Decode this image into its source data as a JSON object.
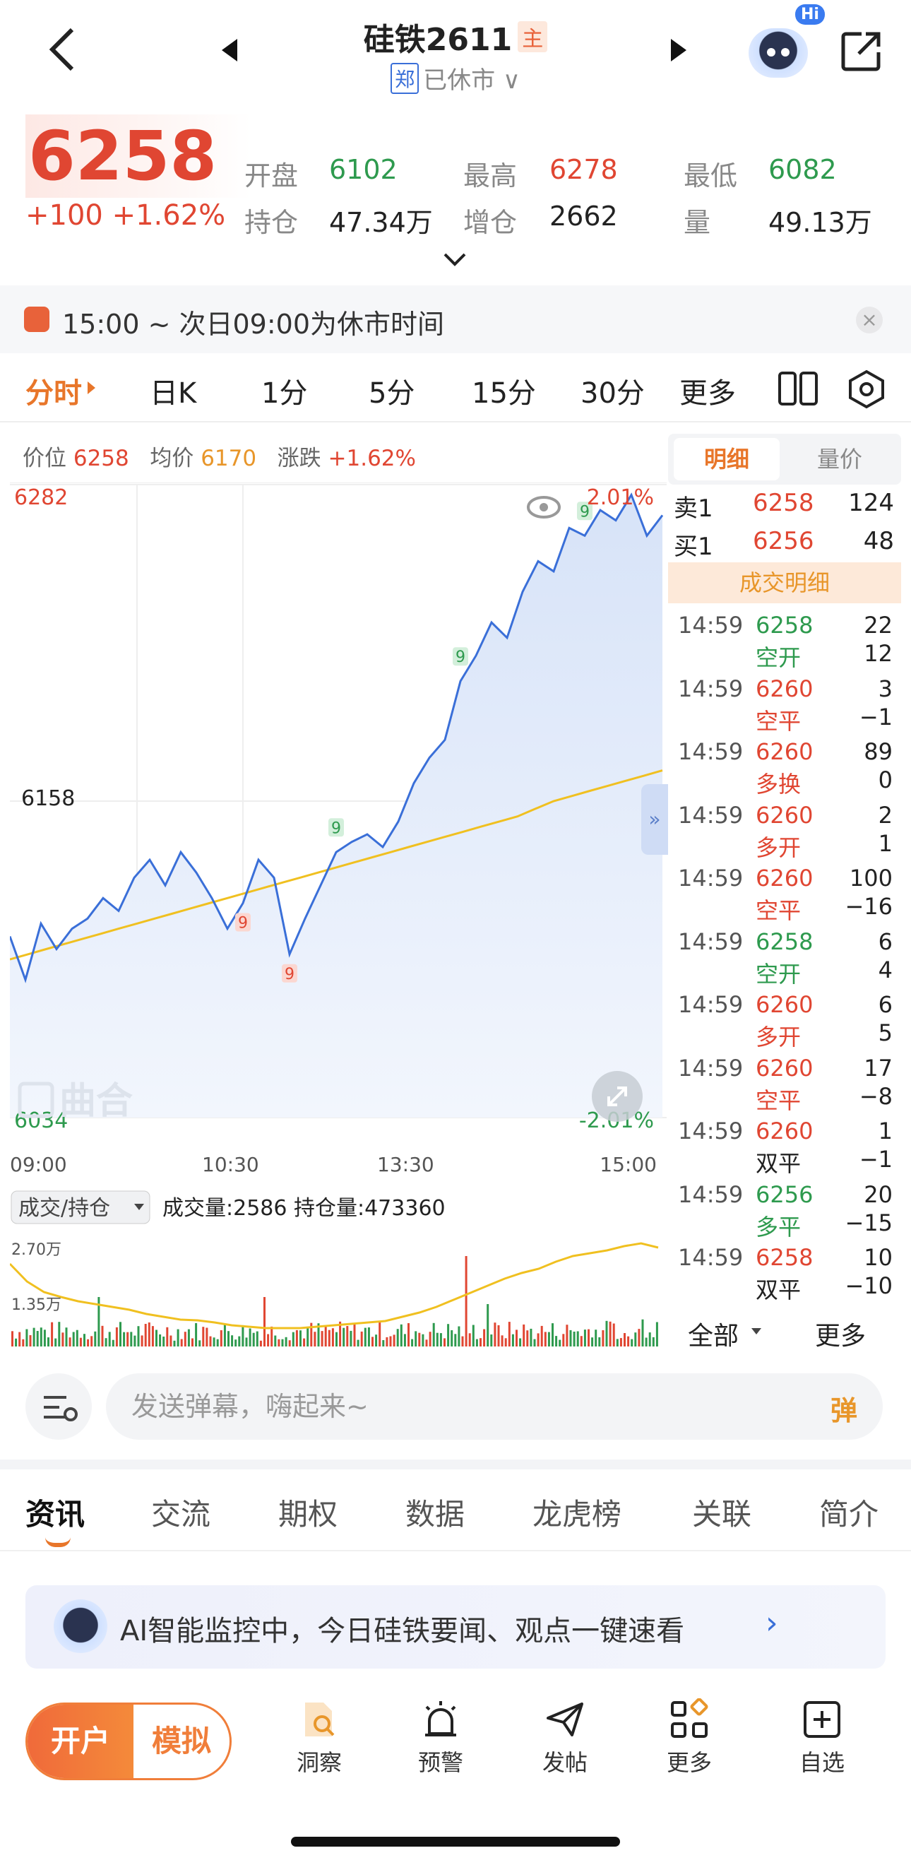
{
  "header": {
    "title": "硅铁2611",
    "badge": "主",
    "exchange_badge": "郑",
    "status": "已休市",
    "hi_badge": "Hi"
  },
  "quote": {
    "price": "6258",
    "change": "+100 +1.62%",
    "open_label": "开盘",
    "open": "6102",
    "high_label": "最高",
    "high": "6278",
    "low_label": "最低",
    "low": "6082",
    "oi_label": "持仓",
    "oi": "47.34万",
    "oi_change_label": "增仓",
    "oi_change": "2662",
    "vol_label": "量",
    "vol": "49.13万"
  },
  "notice": {
    "text": "15:00 ~ 次日09:00为休市时间",
    "close": "×"
  },
  "period_tabs": [
    "分时",
    "日K",
    "1分",
    "5分",
    "15分",
    "30分",
    "更多"
  ],
  "chart_info": {
    "price_label": "价位",
    "price": "6258",
    "avg_label": "均价",
    "avg": "6170",
    "chg_label": "涨跌",
    "chg": "+1.62%"
  },
  "chart_data": {
    "type": "line",
    "x_ticks": [
      "09:00",
      "10:30",
      "13:30",
      "15:00"
    ],
    "y_max_label": "6282",
    "y_mid_label": "6158",
    "y_min_label": "6034",
    "pct_max_label": "2.01%",
    "pct_min_label": "-2.01%",
    "ylim": [
      6034,
      6282
    ],
    "series": [
      {
        "values": [
          6105,
          6088,
          6110,
          6100,
          6108,
          6112,
          6120,
          6115,
          6128,
          6135,
          6125,
          6138,
          6130,
          6120,
          6108,
          6118,
          6135,
          6128,
          6098,
          6112,
          6125,
          6138,
          6142,
          6145,
          6140,
          6150,
          6165,
          6175,
          6182,
          6205,
          6215,
          6228,
          6222,
          6240,
          6252,
          6248,
          6265,
          6262,
          6272,
          6268,
          6278,
          6262,
          6270
        ]
      },
      {
        "values": [
          6096,
          6098,
          6100,
          6102,
          6104,
          6106,
          6108,
          6110,
          6112,
          6114,
          6116,
          6118,
          6120,
          6122,
          6124,
          6126,
          6128,
          6130,
          6132,
          6134,
          6136,
          6138,
          6140,
          6142,
          6144,
          6146,
          6148,
          6150,
          6152,
          6155,
          6158,
          6160,
          6162,
          6164,
          6166,
          6168,
          6170
        ]
      }
    ],
    "markers": [
      {
        "label": "9",
        "x_index": 15,
        "color": "#e04632"
      },
      {
        "label": "9",
        "x_index": 18,
        "color": "#e04632"
      },
      {
        "label": "9",
        "x_index": 21,
        "color": "#2e9a4e"
      },
      {
        "label": "9",
        "x_index": 29,
        "color": "#2e9a4e"
      },
      {
        "label": "9",
        "x_index": 37,
        "color": "#2e9a4e"
      }
    ],
    "watermark": "曲合"
  },
  "volume": {
    "selector": "成交/持仓",
    "summary": "成交量:2586 持仓量:473360",
    "top_label": "2.70万",
    "mid_label": "1.35万"
  },
  "side": {
    "tabs": [
      "明细",
      "量价"
    ],
    "ask": {
      "label": "卖1",
      "price": "6258",
      "qty": "124"
    },
    "bid": {
      "label": "买1",
      "price": "6256",
      "qty": "48"
    },
    "trades_title": "成交明细",
    "trades": [
      {
        "time": "14:59",
        "price": "6258",
        "qty": "22",
        "type": "空开",
        "oi": "12",
        "pc": "green",
        "tc": "green"
      },
      {
        "time": "14:59",
        "price": "6260",
        "qty": "3",
        "type": "空平",
        "oi": "−1",
        "pc": "red",
        "tc": "red"
      },
      {
        "time": "14:59",
        "price": "6260",
        "qty": "89",
        "type": "多换",
        "oi": "0",
        "pc": "red",
        "tc": "red"
      },
      {
        "time": "14:59",
        "price": "6260",
        "qty": "2",
        "type": "多开",
        "oi": "1",
        "pc": "red",
        "tc": "red"
      },
      {
        "time": "14:59",
        "price": "6260",
        "qty": "100",
        "type": "空平",
        "oi": "−16",
        "pc": "red",
        "tc": "red"
      },
      {
        "time": "14:59",
        "price": "6258",
        "qty": "6",
        "type": "空开",
        "oi": "4",
        "pc": "green",
        "tc": "green"
      },
      {
        "time": "14:59",
        "price": "6260",
        "qty": "6",
        "type": "多开",
        "oi": "5",
        "pc": "red",
        "tc": "red"
      },
      {
        "time": "14:59",
        "price": "6260",
        "qty": "17",
        "type": "空平",
        "oi": "−8",
        "pc": "red",
        "tc": "red"
      },
      {
        "time": "14:59",
        "price": "6260",
        "qty": "1",
        "type": "双平",
        "oi": "−1",
        "pc": "red",
        "tc": "dark"
      },
      {
        "time": "14:59",
        "price": "6256",
        "qty": "20",
        "type": "多平",
        "oi": "−15",
        "pc": "green",
        "tc": "green"
      },
      {
        "time": "14:59",
        "price": "6258",
        "qty": "10",
        "type": "双平",
        "oi": "−10",
        "pc": "red",
        "tc": "dark"
      }
    ],
    "all_label": "全部",
    "more_label": "更多"
  },
  "danmaku": {
    "placeholder": "发送弹幕，嗨起来~",
    "button": "弹"
  },
  "news_tabs": [
    "资讯",
    "交流",
    "期权",
    "数据",
    "龙虎榜",
    "关联",
    "简介"
  ],
  "ai_banner": "AI智能监控中，今日硅铁要闻、观点一键速看",
  "bottom_bar": {
    "open_account": "开户",
    "simulate": "模拟",
    "items": [
      "洞察",
      "预警",
      "发帖",
      "更多",
      "自选"
    ]
  },
  "colors": {
    "up": "#e04632",
    "down": "#2e9a4e",
    "accent": "#e8762a",
    "line": "#3a6fd8",
    "avg": "#f0c020"
  }
}
